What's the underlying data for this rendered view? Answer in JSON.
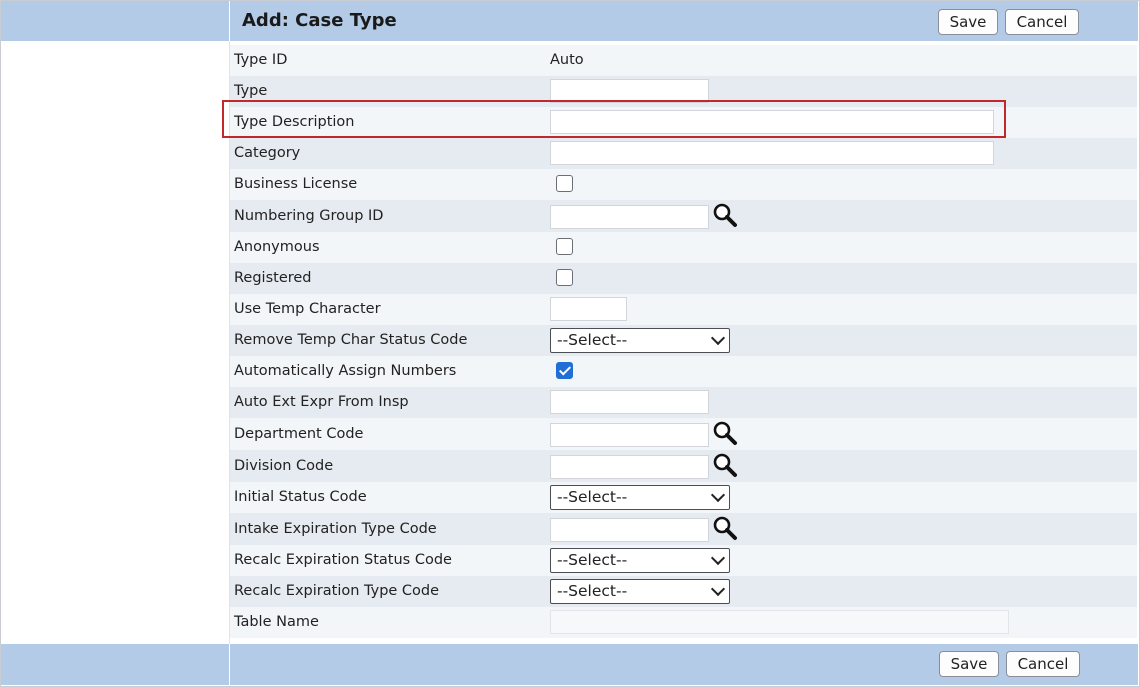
{
  "header": {
    "title": "Add: Case Type",
    "save_label": "Save",
    "cancel_label": "Cancel"
  },
  "footer": {
    "save_label": "Save",
    "cancel_label": "Cancel"
  },
  "fields": {
    "type_id": {
      "label": "Type ID",
      "value": "Auto"
    },
    "type": {
      "label": "Type",
      "value": ""
    },
    "type_description": {
      "label": "Type Description",
      "value": ""
    },
    "category": {
      "label": "Category",
      "value": ""
    },
    "business_license": {
      "label": "Business License",
      "checked": false
    },
    "numbering_group_id": {
      "label": "Numbering Group ID",
      "value": ""
    },
    "anonymous": {
      "label": "Anonymous",
      "checked": false
    },
    "registered": {
      "label": "Registered",
      "checked": false
    },
    "use_temp_character": {
      "label": "Use Temp Character",
      "value": ""
    },
    "remove_temp_char_status_code": {
      "label": "Remove Temp Char Status Code",
      "selected": "--Select--"
    },
    "automatically_assign_numbers": {
      "label": "Automatically Assign Numbers",
      "checked": true
    },
    "auto_ext_expr_from_insp": {
      "label": "Auto Ext Expr From Insp",
      "value": ""
    },
    "department_code": {
      "label": "Department Code",
      "value": ""
    },
    "division_code": {
      "label": "Division Code",
      "value": ""
    },
    "initial_status_code": {
      "label": "Initial Status Code",
      "selected": "--Select--"
    },
    "intake_expiration_type_code": {
      "label": "Intake Expiration Type Code",
      "value": ""
    },
    "recalc_expiration_status_code": {
      "label": "Recalc Expiration Status Code",
      "selected": "--Select--"
    },
    "recalc_expiration_type_code": {
      "label": "Recalc Expiration Type Code",
      "selected": "--Select--"
    },
    "table_name": {
      "label": "Table Name",
      "value": ""
    }
  },
  "icons": {
    "lookup": "magnifier-icon",
    "dropdown": "chevron-down-icon"
  },
  "colors": {
    "header_bar": "#b3cbe7",
    "highlight": "#c0282b",
    "checkbox_checked": "#1f6fd6"
  }
}
